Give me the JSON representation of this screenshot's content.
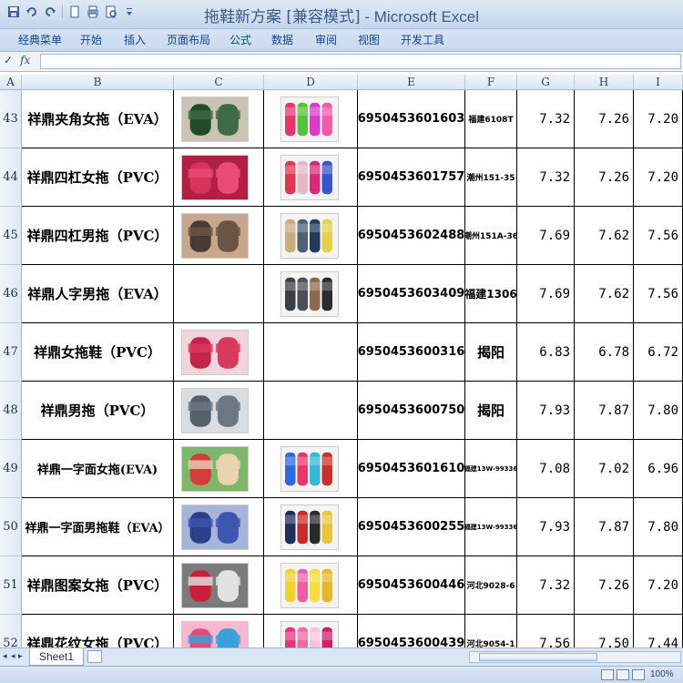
{
  "window": {
    "title_part1": "拖鞋新方案  [兼容模式]",
    "title_part2": " - Microsoft Excel"
  },
  "ribbon": {
    "tabs": [
      "经典菜单",
      "开始",
      "插入",
      "页面布局",
      "公式",
      "数据",
      "审阅",
      "视图",
      "开发工具"
    ]
  },
  "formula_bar": {
    "fx_label": "fx",
    "check_label": "✓",
    "value": ""
  },
  "columns": [
    "A",
    "B",
    "C",
    "D",
    "E",
    "F",
    "G",
    "H",
    "I"
  ],
  "rows": [
    {
      "num": "43",
      "name": "祥鼎夹角女拖（EVA）",
      "barcode": "6950453601603",
      "origin": "福建6108T",
      "origin_size": "small",
      "g": "7.32",
      "h": "7.26",
      "i": "7.20",
      "img_c": true,
      "img_d": true,
      "c_colors": [
        "#1f4d2a",
        "#3d6b46",
        "#c9c3b4"
      ],
      "d_colors": [
        "#e8336d",
        "#55c23a",
        "#d83cc7",
        "#f35aa8"
      ]
    },
    {
      "num": "44",
      "name": "祥鼎四杠女拖（PVC）",
      "barcode": "6950453601757",
      "origin": "潮州151-35",
      "origin_size": "small",
      "g": "7.32",
      "h": "7.26",
      "i": "7.20",
      "img_c": true,
      "img_d": true,
      "c_colors": [
        "#d8335c",
        "#e84c74",
        "#b21f45"
      ],
      "d_colors": [
        "#e43454",
        "#e4b8c6",
        "#d42c78",
        "#3856c8"
      ]
    },
    {
      "num": "45",
      "name": "祥鼎四杠男拖（PVC）",
      "barcode": "6950453602488",
      "origin": "潮州151A-36",
      "origin_size": "small",
      "g": "7.69",
      "h": "7.62",
      "i": "7.56",
      "img_c": true,
      "img_d": true,
      "c_colors": [
        "#4a3a32",
        "#6b5446",
        "#c6a88e"
      ],
      "d_colors": [
        "#c9ad7c",
        "#4d6078",
        "#243a5c",
        "#e6d04a"
      ]
    },
    {
      "num": "46",
      "name": "祥鼎人字男拖（EVA）",
      "barcode": "6950453603409",
      "origin": "福建1306",
      "origin_size": "normal",
      "g": "7.69",
      "h": "7.62",
      "i": "7.56",
      "img_c": false,
      "img_d": true,
      "d_colors": [
        "#3b3f44",
        "#4a4f55",
        "#8a6a4c",
        "#2a2d30"
      ]
    },
    {
      "num": "47",
      "name": "祥鼎女拖鞋（PVC）",
      "barcode": "6950453600316",
      "origin": "揭阳",
      "origin_size": "large",
      "g": "6.83",
      "h": "6.78",
      "i": "6.72",
      "img_c": true,
      "img_d": false,
      "c_colors": [
        "#c6234c",
        "#d8395e",
        "#f0d6dc"
      ]
    },
    {
      "num": "48",
      "name": "祥鼎男拖（PVC）",
      "barcode": "6950453600750",
      "origin": "揭阳",
      "origin_size": "large",
      "g": "7.93",
      "h": "7.87",
      "i": "7.80",
      "img_c": true,
      "img_d": false,
      "c_colors": [
        "#56606c",
        "#6d7784",
        "#d9dde2"
      ]
    },
    {
      "num": "49",
      "name": "祥鼎一字面女拖(EVA)",
      "barcode": "6950453601610",
      "origin": "福建13W-99336",
      "origin_size": "tiny",
      "g": "7.08",
      "h": "7.02",
      "i": "6.96",
      "img_c": true,
      "img_d": true,
      "c_colors": [
        "#d63b3b",
        "#e9d3b0",
        "#7fb66a"
      ],
      "d_colors": [
        "#2c6bd8",
        "#e8366b",
        "#37b6d4",
        "#c8302e"
      ]
    },
    {
      "num": "50",
      "name": "祥鼎一字面男拖鞋（EVA）",
      "barcode": "6950453600255",
      "origin": "福建13W-99336",
      "origin_size": "tiny",
      "g": "7.93",
      "h": "7.87",
      "i": "7.80",
      "img_c": true,
      "img_d": true,
      "c_colors": [
        "#2c3f8a",
        "#3e56b0",
        "#a6b4d9"
      ],
      "d_colors": [
        "#1f2e5c",
        "#c92b2b",
        "#2a2a2a",
        "#e7c73a"
      ]
    },
    {
      "num": "51",
      "name": "祥鼎图案女拖（PVC）",
      "barcode": "6950453600446",
      "origin": "河北9028-6",
      "origin_size": "small",
      "g": "7.32",
      "h": "7.26",
      "i": "7.20",
      "img_c": true,
      "img_d": true,
      "c_colors": [
        "#c91f3a",
        "#e2e2e2",
        "#7b7b7b"
      ],
      "d_colors": [
        "#f2d12a",
        "#ee5fa2",
        "#f5dd45",
        "#e8b82a"
      ]
    },
    {
      "num": "52",
      "name": "祥鼎花纹女拖（PVC）",
      "barcode": "6950453600439",
      "origin": "河北9054-1",
      "origin_size": "small",
      "g": "7.56",
      "h": "7.50",
      "i": "7.44",
      "img_c": true,
      "img_d": true,
      "c_colors": [
        "#e24a7a",
        "#3aa0d8",
        "#f7b8cf"
      ],
      "d_colors": [
        "#e8337d",
        "#f06aa3",
        "#f9c4dc",
        "#d31f6a"
      ]
    }
  ],
  "sheet_tab": "Sheet1",
  "status": {
    "zoom": "100%"
  }
}
